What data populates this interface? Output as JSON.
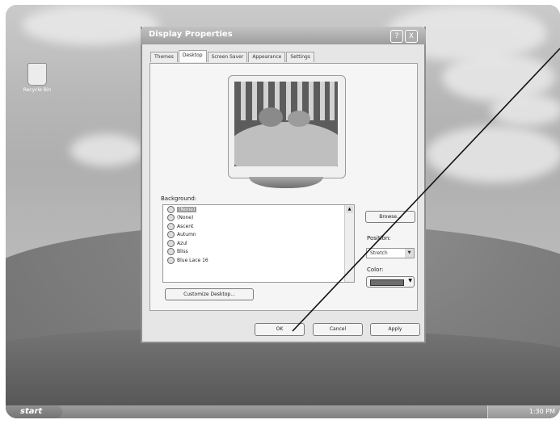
{
  "desktop": {
    "recycle_bin_label": "Recycle Bin"
  },
  "taskbar": {
    "start_label": "start",
    "clock": "1:30 PM"
  },
  "dialog": {
    "title": "Display Properties",
    "help_button": "?",
    "close_button": "X",
    "tabs": [
      {
        "label": "Themes"
      },
      {
        "label": "Desktop"
      },
      {
        "label": "Screen Saver"
      },
      {
        "label": "Appearance"
      },
      {
        "label": "Settings"
      }
    ],
    "background_label": "Background:",
    "background_items": [
      {
        "label": "(None)"
      },
      {
        "label": "(None)"
      },
      {
        "label": "Ascent"
      },
      {
        "label": "Autumn"
      },
      {
        "label": "Azul"
      },
      {
        "label": "Bliss"
      },
      {
        "label": "Blue Lace 16"
      }
    ],
    "browse_label": "Browse...",
    "position_label": "Position:",
    "position_value": "Stretch",
    "color_label": "Color:",
    "customize_label": "Customize Desktop...",
    "ok_label": "OK",
    "cancel_label": "Cancel",
    "apply_label": "Apply"
  }
}
